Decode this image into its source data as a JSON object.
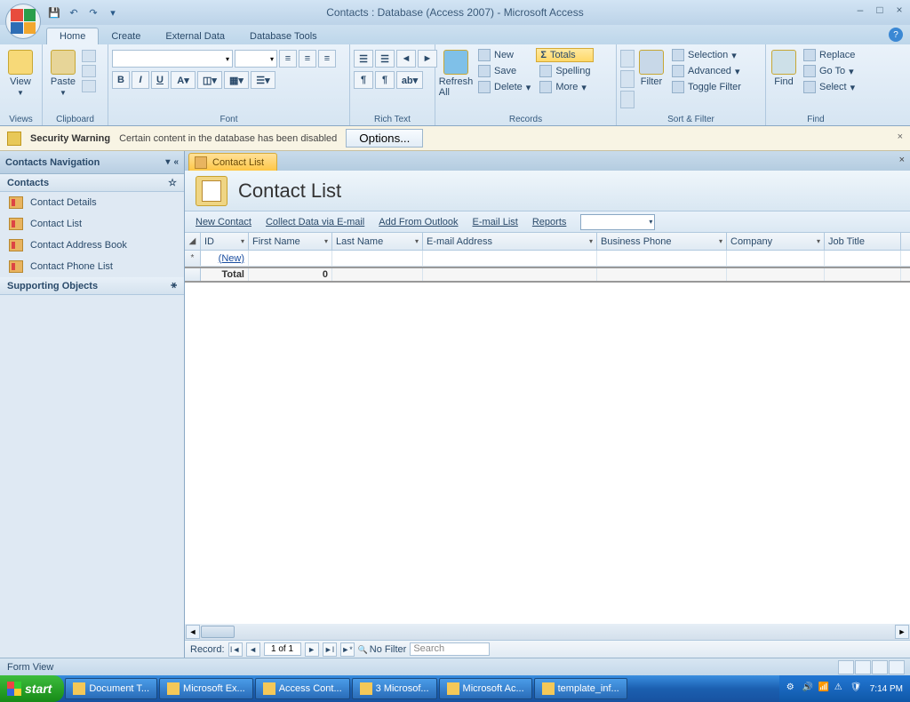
{
  "titlebar": {
    "title": "Contacts : Database (Access 2007) - Microsoft Access"
  },
  "tabs": {
    "items": [
      "Home",
      "Create",
      "External Data",
      "Database Tools"
    ],
    "active": 0
  },
  "ribbon": {
    "views": {
      "label": "Views",
      "view": "View"
    },
    "clipboard": {
      "label": "Clipboard",
      "paste": "Paste"
    },
    "font": {
      "label": "Font"
    },
    "richtext": {
      "label": "Rich Text"
    },
    "records": {
      "label": "Records",
      "refresh": "Refresh All",
      "new": "New",
      "save": "Save",
      "delete": "Delete",
      "totals": "Totals",
      "spelling": "Spelling",
      "more": "More"
    },
    "sortfilter": {
      "label": "Sort & Filter",
      "filter": "Filter",
      "selection": "Selection",
      "advanced": "Advanced",
      "toggle": "Toggle Filter"
    },
    "find": {
      "label": "Find",
      "find": "Find",
      "replace": "Replace",
      "goto": "Go To",
      "select": "Select"
    }
  },
  "security": {
    "title": "Security Warning",
    "msg": "Certain content in the database has been disabled",
    "options": "Options..."
  },
  "nav": {
    "title": "Contacts Navigation",
    "groups": [
      {
        "name": "Contacts",
        "items": [
          "Contact Details",
          "Contact List",
          "Contact Address Book",
          "Contact Phone List"
        ]
      },
      {
        "name": "Supporting Objects",
        "items": []
      }
    ]
  },
  "doc": {
    "tab": "Contact List",
    "header": "Contact List",
    "bar": {
      "newcontact": "New Contact",
      "collect": "Collect Data via E-mail",
      "outlook": "Add From Outlook",
      "emaillist": "E-mail List",
      "reports": "Reports"
    },
    "columns": [
      "ID",
      "First Name",
      "Last Name",
      "E-mail Address",
      "Business Phone",
      "Company",
      "Job Title"
    ],
    "newrow": "(New)",
    "totalrow": {
      "label": "Total",
      "value": "0"
    },
    "recnav": {
      "label": "Record:",
      "position": "1 of 1",
      "nofilter": "No Filter",
      "search": "Search"
    }
  },
  "status": {
    "text": "Form View"
  },
  "taskbar": {
    "start": "start",
    "items": [
      "Document T...",
      "Microsoft Ex...",
      "Access Cont...",
      "3 Microsof...",
      "Microsoft Ac...",
      "template_inf..."
    ],
    "clock": "7:14 PM"
  }
}
